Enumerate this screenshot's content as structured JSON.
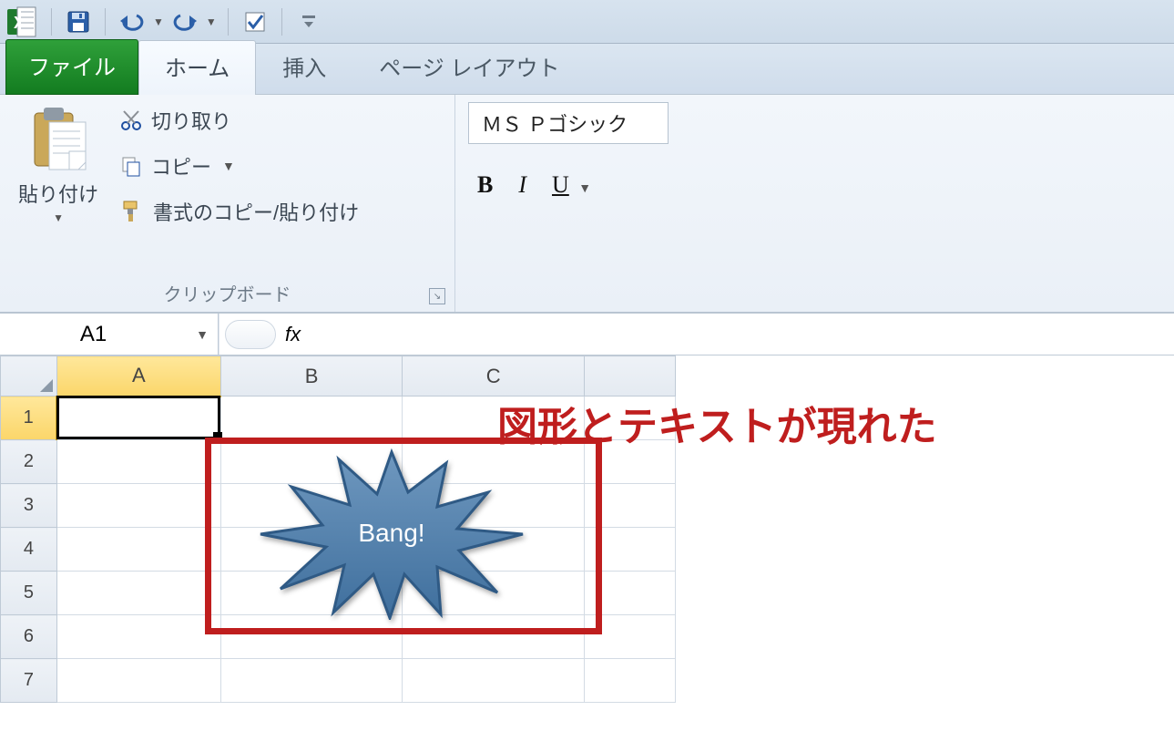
{
  "qat": {
    "app": "Excel"
  },
  "tabs": {
    "file": "ファイル",
    "home": "ホーム",
    "insert": "挿入",
    "pagelayout": "ページ レイアウト"
  },
  "ribbon": {
    "paste": "貼り付け",
    "cut": "切り取り",
    "copy": "コピー",
    "format_painter": "書式のコピー/貼り付け",
    "clipboard_label": "クリップボード",
    "font_name": "ＭＳ Ｐゴシック",
    "bold": "B",
    "italic": "I",
    "underline": "U"
  },
  "namebox": "A1",
  "fx_label": "fx",
  "formula_value": "",
  "columns": [
    "A",
    "B",
    "C"
  ],
  "rows": [
    "1",
    "2",
    "3",
    "4",
    "5",
    "6",
    "7"
  ],
  "selected_cell": "A1",
  "shape_text": "Bang!",
  "annotation": "図形とテキストが現れた"
}
